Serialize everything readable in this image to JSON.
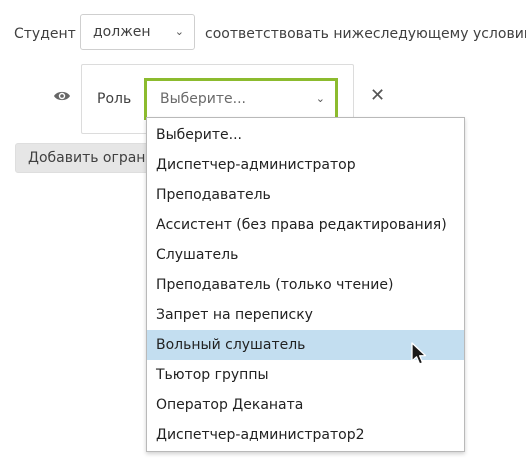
{
  "condition": {
    "subject_label": "Студент",
    "must_select_value": "должен",
    "condition_text": "соответствовать нижеследующему условию"
  },
  "restriction": {
    "role_label": "Роль",
    "role_select_value": "Выберите..."
  },
  "add_button_label": "Добавить ограничение",
  "dropdown": {
    "options": [
      "Выберите...",
      "Диспетчер-администратор",
      "Преподаватель",
      "Ассистент (без права редактирования)",
      "Слушатель",
      "Преподаватель (только чтение)",
      "Запрет на переписку",
      "Вольный слушатель",
      "Тьютор группы",
      "Оператор Деканата",
      "Диспетчер-администратор2"
    ],
    "highlighted": "Вольный слушатель"
  },
  "icons": {
    "eye": "eye-icon",
    "close": "close-icon",
    "chevron": "chevron-down-icon",
    "cursor": "mouse-cursor-icon"
  },
  "colors": {
    "focus_border": "#8cbb2e",
    "highlight": "#c3def0"
  }
}
